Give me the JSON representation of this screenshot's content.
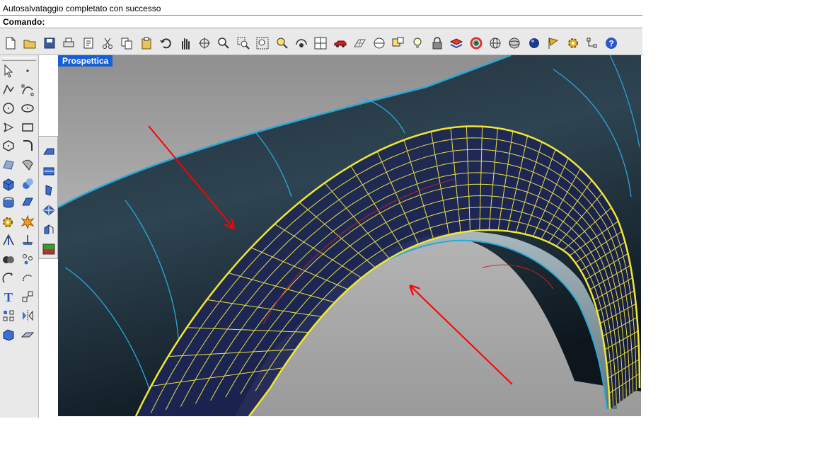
{
  "command_history": {
    "last_message": "Autosalvataggio completato con successo"
  },
  "command_line": {
    "label": "Comando:",
    "value": ""
  },
  "viewport": {
    "title": "Prospettica"
  },
  "colors": {
    "viewport_title_bg": "#1560d8",
    "wireframe_edge": "#f0e830",
    "surface_edge": "#2aa8d8",
    "annotation_arrow": "#ff0000"
  },
  "main_toolbar": {
    "icons": [
      "new-file-icon",
      "open-folder-icon",
      "save-icon",
      "print-icon",
      "properties-icon",
      "cut-icon",
      "copy-icon",
      "paste-icon",
      "undo-icon",
      "pan-hand-icon",
      "rotate-view-icon",
      "zoom-icon",
      "zoom-window-icon",
      "zoom-extents-icon",
      "zoom-selected-icon",
      "named-views-icon",
      "four-viewports-icon",
      "car-icon",
      "grid-icon",
      "cplane-icon",
      "osnap-icon",
      "light-bulb-icon",
      "lock-icon",
      "layer-icon",
      "color-wheel-icon",
      "wireframe-sphere-icon",
      "shaded-sphere-icon",
      "rendered-sphere-icon",
      "flag-icon",
      "settings-gear-icon",
      "select-points-icon",
      "help-icon"
    ]
  },
  "left_toolbar": {
    "icons": [
      "select-arrow-icon",
      "point-icon",
      "polyline-icon",
      "curve-points-icon",
      "circle-icon",
      "ellipse-icon",
      "arc-icon",
      "rectangle-icon",
      "polygon-icon",
      "fillet-curve-icon",
      "surface-points-icon",
      "loft-surface-icon",
      "box-solid-icon",
      "sphere-solid-icon",
      "cylinder-solid-icon",
      "plane-surface-icon",
      "gear-tool-icon",
      "explode-icon",
      "split-icon",
      "project-icon",
      "boolean-icon",
      "points-cloud-icon",
      "rotate-icon",
      "arc-rotate-icon",
      "text-icon",
      "scale-icon",
      "array-icon",
      "mirror-icon",
      "extrude-icon",
      "dimension-icon"
    ]
  },
  "flyout_toolbar": {
    "icons": [
      "surface-extrude-icon",
      "surface-edge-icon",
      "surface-patch-icon",
      "surface-network-icon",
      "surface-blend-icon",
      "surface-analysis-icon"
    ]
  }
}
